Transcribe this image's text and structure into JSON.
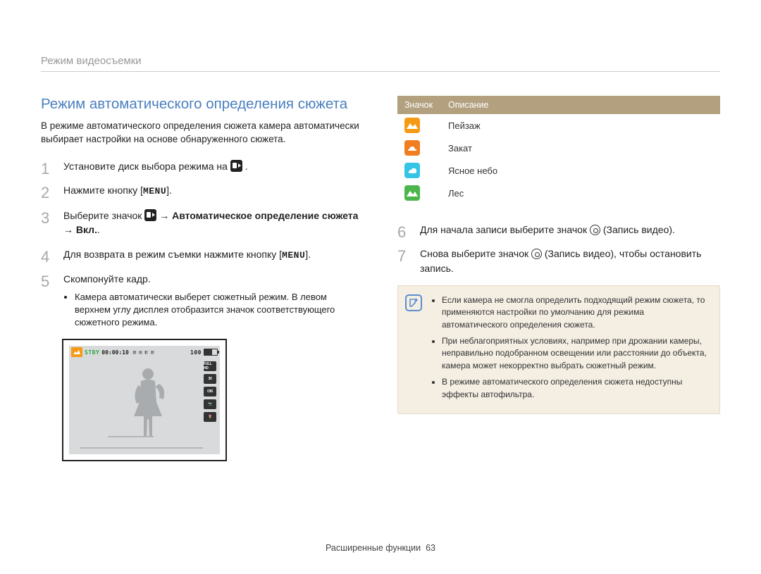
{
  "header": {
    "breadcrumb": "Режим видеосъемки"
  },
  "main": {
    "title": "Режим автоматического определения сюжета",
    "intro": "В режиме автоматического определения сюжета камера автоматически выбирает настройки на основе обнаруженного сюжета.",
    "steps_a": {
      "s1": {
        "text": "Установите диск выбора режима на "
      },
      "s2": {
        "pre": "Нажмите кнопку [",
        "menu": "MENU",
        "post": "]."
      },
      "s3": {
        "pre": "Выберите значок ",
        "arrow": " → ",
        "bold": "Автоматическое определение сюжета → Вкл.",
        "tail": "."
      },
      "s4": {
        "pre": "Для возврата в режим съемки нажмите кнопку [",
        "menu": "MENU",
        "post": "]."
      },
      "s5": {
        "text": "Скомпонуйте кадр.",
        "bullet": "Камера автоматически выберет сюжетный режим. В левом верхнем углу дисплея отобразится значок соответствующего сюжетного режима."
      }
    },
    "lcd": {
      "stby": "STBY",
      "time": "00:00:10",
      "batt": "100",
      "side": [
        "FULL HD",
        "30",
        "OIS",
        "📷",
        "🌷"
      ]
    },
    "icons_table": {
      "head_icon": "Значок",
      "head_desc": "Описание",
      "rows": [
        {
          "desc": "Пейзаж"
        },
        {
          "desc": "Закат"
        },
        {
          "desc": "Ясное небо"
        },
        {
          "desc": "Лес"
        }
      ]
    },
    "steps_b": {
      "s6": {
        "pre": "Для начала записи выберите значок ",
        "mid": " (Запись видео)."
      },
      "s7": {
        "pre": "Снова выберите значок ",
        "mid": " (Запись видео), чтобы остановить запись."
      }
    },
    "notes": [
      "Если камера не смогла определить подходящий режим сюжета, то применяются настройки по умолчанию для режима автоматического определения сюжета.",
      "При неблагоприятных условиях, например при дрожании камеры, неправильно подобранном освещении или расстоянии до объекта, камера может некорректно выбрать сюжетный режим.",
      "В режиме автоматического определения сюжета недоступны эффекты автофильтра."
    ]
  },
  "footer": {
    "section": "Расширенные функции",
    "page": "63"
  }
}
